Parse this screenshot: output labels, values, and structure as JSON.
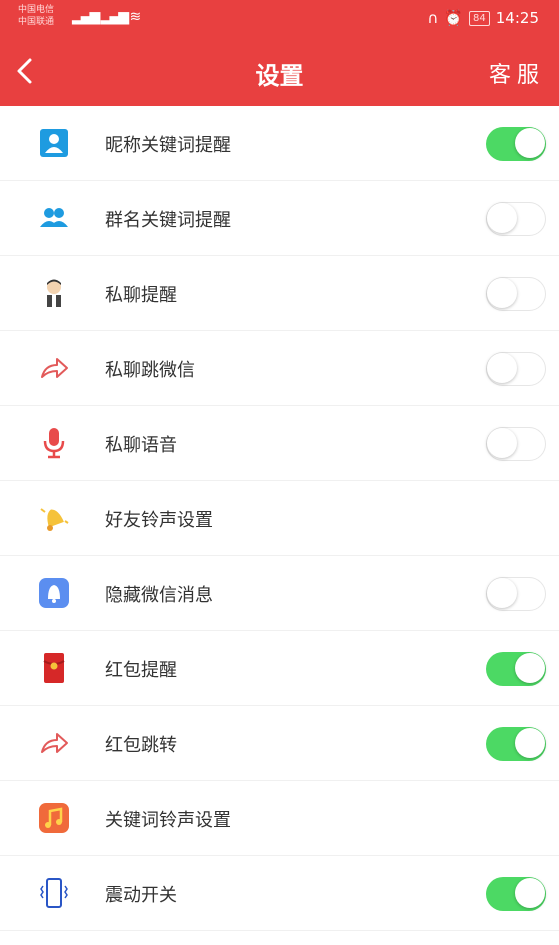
{
  "status_bar": {
    "carrier_1": "中国电信",
    "carrier_2": "中国联通",
    "time": "14:25",
    "battery": "84"
  },
  "header": {
    "title": "设置",
    "service_label": "客服"
  },
  "colors": {
    "header_red": "#e84040",
    "toggle_on": "#4cd964",
    "toggle_off_border": "#e6e6e6"
  },
  "settings": [
    {
      "label": "昵称关键词提醒",
      "icon": "contact-card-icon",
      "toggle": true
    },
    {
      "label": "群名关键词提醒",
      "icon": "group-users-icon",
      "toggle": false
    },
    {
      "label": "私聊提醒",
      "icon": "person-avatar-icon",
      "toggle": false
    },
    {
      "label": "私聊跳微信",
      "icon": "forward-arrow-icon",
      "toggle": false
    },
    {
      "label": "私聊语音",
      "icon": "microphone-icon",
      "toggle": false
    },
    {
      "label": "好友铃声设置",
      "icon": "bell-icon",
      "toggle": null
    },
    {
      "label": "隐藏微信消息",
      "icon": "notification-bell-icon",
      "toggle": false
    },
    {
      "label": "红包提醒",
      "icon": "red-envelope-icon",
      "toggle": true
    },
    {
      "label": "红包跳转",
      "icon": "forward-arrow-icon",
      "toggle": true
    },
    {
      "label": "关键词铃声设置",
      "icon": "music-note-icon",
      "toggle": null
    },
    {
      "label": "震动开关",
      "icon": "vibrate-phone-icon",
      "toggle": true
    }
  ]
}
